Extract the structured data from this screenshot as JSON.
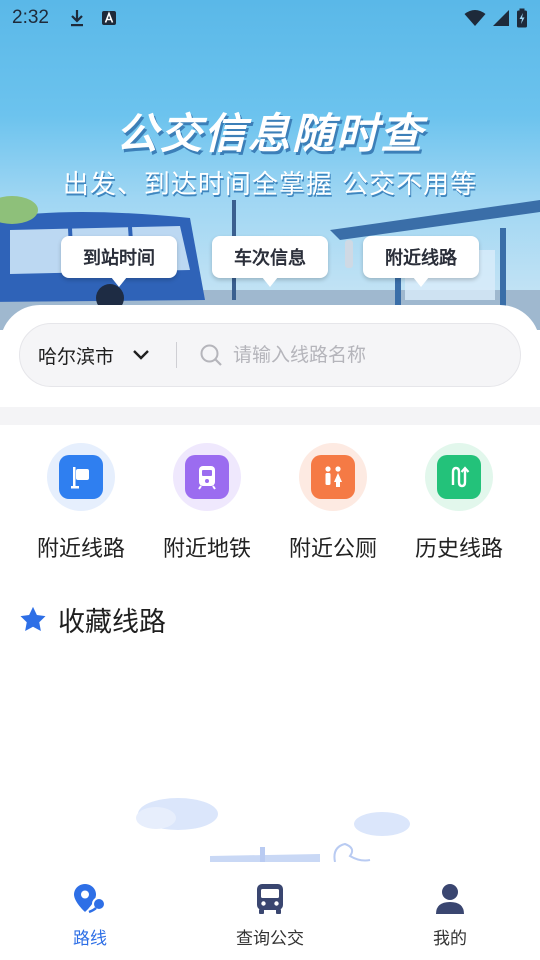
{
  "status_bar": {
    "time": "2:32"
  },
  "banner": {
    "headline": "公交信息随时查",
    "subheadline": "出发、到达时间全掌握 公交不用等",
    "chips": [
      "到站时间",
      "车次信息",
      "附近线路"
    ]
  },
  "search": {
    "city": "哈尔滨市",
    "placeholder": "请输入线路名称"
  },
  "quick_actions": [
    {
      "label": "附近线路",
      "icon": "flag-icon",
      "color": "#2f7ff0"
    },
    {
      "label": "附近地铁",
      "icon": "subway-icon",
      "color": "#9b6cf0"
    },
    {
      "label": "附近公厕",
      "icon": "restroom-icon",
      "color": "#f57a45"
    },
    {
      "label": "历史线路",
      "icon": "history-route-icon",
      "color": "#23c27a"
    }
  ],
  "favorites": {
    "title": "收藏线路"
  },
  "tabs": [
    {
      "label": "路线",
      "icon": "route-pin-icon",
      "active": true
    },
    {
      "label": "查询公交",
      "icon": "bus-icon",
      "active": false
    },
    {
      "label": "我的",
      "icon": "user-icon",
      "active": false
    }
  ],
  "colors": {
    "accent": "#2e6fe6",
    "star": "#2e6fe6"
  }
}
